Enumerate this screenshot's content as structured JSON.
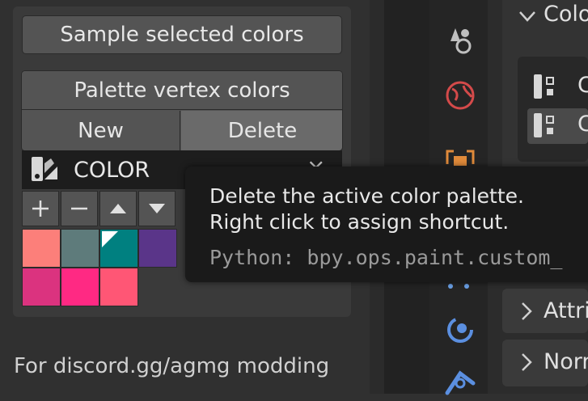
{
  "panel": {
    "sample_button": "Sample selected colors",
    "palette_title": "Palette vertex colors",
    "new_button": "New",
    "delete_button": "Delete",
    "palette_selector": {
      "label": "COLOR",
      "clear_glyph": "×"
    },
    "tools": [
      {
        "name": "add-color-button",
        "glyph": "+"
      },
      {
        "name": "remove-color-button",
        "glyph": "−"
      },
      {
        "name": "move-up-button",
        "glyph": "▲"
      },
      {
        "name": "move-down-button",
        "glyph": "▼"
      }
    ],
    "swatches_row1": [
      "#fc7f7a",
      "#5e7b7b",
      "#008080",
      "#5a3589"
    ],
    "swatches_row2": [
      "#db337f",
      "#ff2983",
      "#ff5675"
    ]
  },
  "footer_text": "For discord.gg/agmg modding",
  "tooltip": {
    "line1": "Delete the active color palette.",
    "line2": "Right click to assign shortcut.",
    "python": "Python: bpy.ops.paint.custom_"
  },
  "right_panel": {
    "section_header": "Colo",
    "list_item_1": "C",
    "list_item_2": "C",
    "attributes_label": "Attri",
    "normals_label": "Norm"
  }
}
